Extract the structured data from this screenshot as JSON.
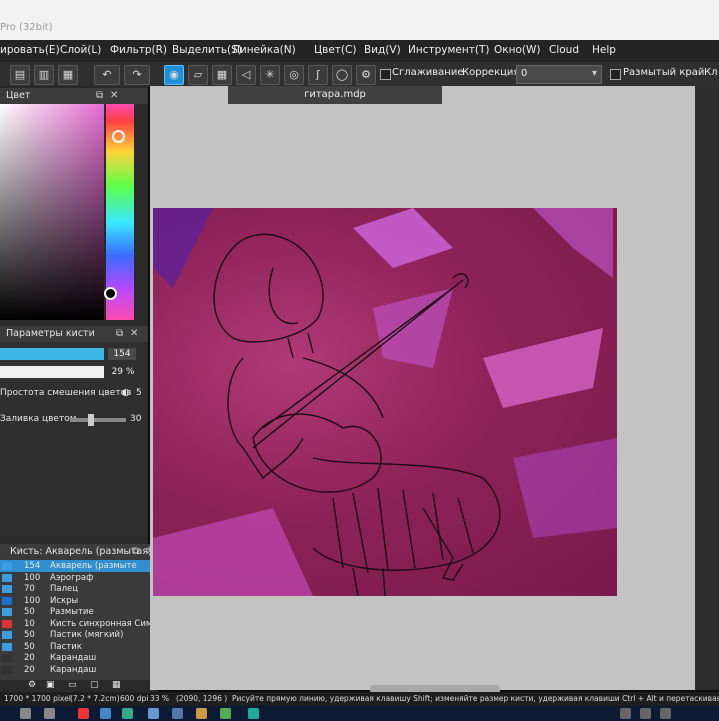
{
  "window": {
    "title_fragment": "Pro (32bit)"
  },
  "menu": [
    "ировать(E)",
    "Слой(L)",
    "Фильтр(R)",
    "Выделить(S)",
    "Линейка(N)",
    "Цвет(C)",
    "Вид(V)",
    "Инструмент(T)",
    "Окно(W)",
    "Cloud",
    "Help"
  ],
  "toolbar": {
    "antialias_label": "Сглаживание",
    "correction_label": "Коррекция",
    "correction_value": "0",
    "blur_edge_label": "Размытый край",
    "trailing": "Кл"
  },
  "color_panel": {
    "title": "Цвет"
  },
  "brush_params": {
    "title": "Параметры кисти",
    "size": "154",
    "opacity": "29 %",
    "blend_label": "Простота смешения цветов",
    "blend_value_fragment": "5",
    "fill_label": "Заливка цветом",
    "fill_value_fragment": "30"
  },
  "brush_list": {
    "title": "Кисть: Акварель (размытая)",
    "items": [
      {
        "size": "154",
        "name": "Акварель (размыте",
        "selected": true,
        "swatch": "#3a9de0"
      },
      {
        "size": "100",
        "name": "Аэрограф",
        "selected": false,
        "swatch": "#3a9de0"
      },
      {
        "size": "70",
        "name": "Палец",
        "selected": false,
        "swatch": "#3a9de0"
      },
      {
        "size": "100",
        "name": "Искры",
        "selected": false,
        "swatch": "#1a6fd0"
      },
      {
        "size": "50",
        "name": "Размытие",
        "selected": false,
        "swatch": "#3a9de0"
      },
      {
        "size": "10",
        "name": "Кисть синхронная Сим",
        "selected": false,
        "swatch": "#d33"
      },
      {
        "size": "50",
        "name": "Пастик (мягкий)",
        "selected": false,
        "swatch": "#3a9de0"
      },
      {
        "size": "50",
        "name": "Пастик",
        "selected": false,
        "swatch": "#3a9de0"
      },
      {
        "size": "20",
        "name": "Карандаш",
        "selected": false,
        "swatch": "#333"
      },
      {
        "size": "20",
        "name": "Карандаш",
        "selected": false,
        "swatch": "#333"
      }
    ]
  },
  "document": {
    "tab_title": "гитара.mdp"
  },
  "status": {
    "dimensions": "1700 * 1700 pixel",
    "cm": "(7.2 * 7.2cm)",
    "dpi": "600 dpi",
    "zoom": "33 %",
    "coords": "(2090, 1296 )",
    "hint": "Рисуйте прямую линию, удерживая клавишу Shift; изменяйте размер кисти, удерживая клавиши Ctrl + Alt и перетаскивая"
  },
  "colors": {
    "accent": "#1f8fd6",
    "artboard": "#8c2257"
  }
}
